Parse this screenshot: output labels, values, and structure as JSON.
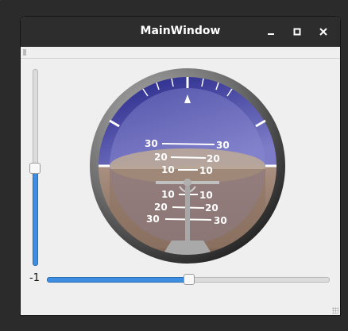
{
  "window": {
    "title": "MainWindow",
    "minimize_icon": "minimize-icon",
    "maximize_icon": "maximize-icon",
    "close_icon": "close-icon"
  },
  "attitude_indicator": {
    "sky_color": "#4040b0",
    "ground_color": "#8b7060",
    "pitch_labels_upper": [
      "30",
      "20",
      "10"
    ],
    "pitch_labels_lower": [
      "10",
      "20",
      "30"
    ]
  },
  "controls": {
    "value_label": "-1",
    "vertical_slider_level_percent": 50,
    "horizontal_slider_level_percent": 50,
    "accent_color": "#3d8ee0"
  }
}
